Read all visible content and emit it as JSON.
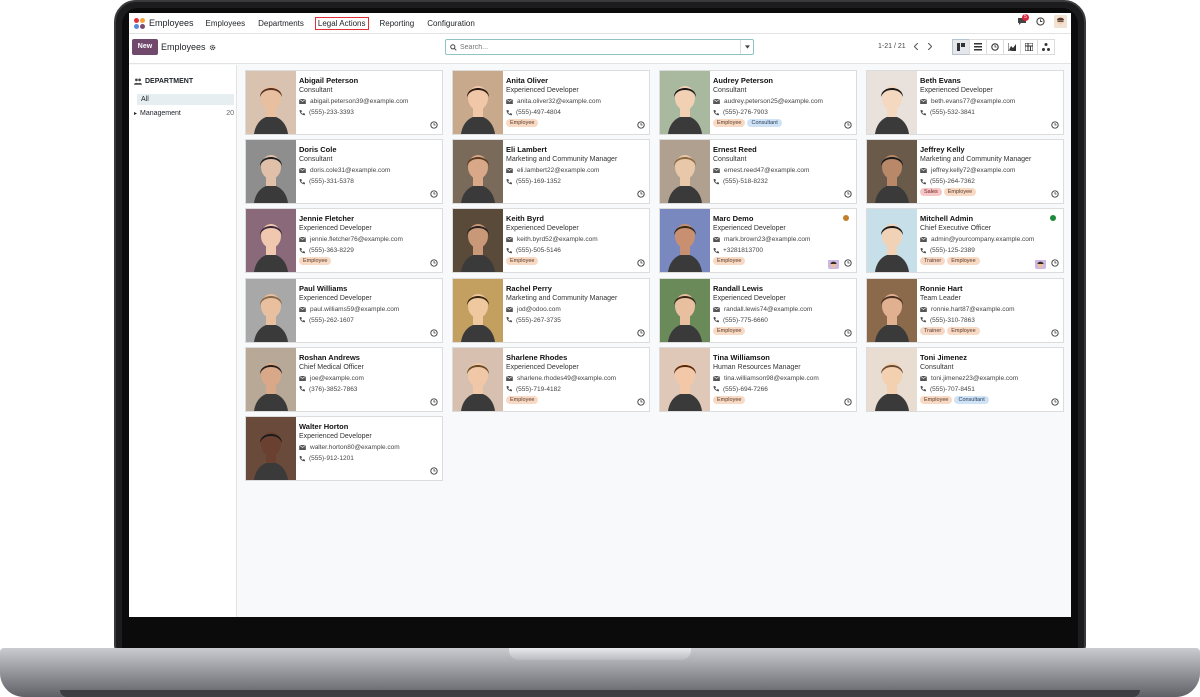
{
  "navbar": {
    "app_name": "Employees",
    "menu": [
      "Employees",
      "Departments",
      "Legal Actions",
      "Reporting",
      "Configuration"
    ],
    "chat_badge": "5",
    "colors": {
      "active_outline": "#e0313a",
      "badge": "#d9233a"
    }
  },
  "control": {
    "new_label": "New",
    "breadcrumb": "Employees",
    "search_placeholder": "Search...",
    "pager": "1-21 / 21",
    "views": [
      "kanban-icon",
      "list-icon",
      "activity-icon",
      "graph-icon",
      "pivot-icon",
      "hierarchy-icon"
    ],
    "colors": {
      "primary": "#71496c"
    }
  },
  "sidebar": {
    "title": "DEPARTMENT",
    "all_label": "All",
    "items": [
      {
        "label": "Management",
        "count": "20"
      }
    ]
  },
  "employees": [
    {
      "name": "Abigail Peterson",
      "job": "Consultant",
      "email": "abigail.peterson39@example.com",
      "phone": "(555)-233-3393",
      "tags": []
    },
    {
      "name": "Anita Oliver",
      "job": "Experienced Developer",
      "email": "anita.oliver32@example.com",
      "phone": "(555)-497-4804",
      "tags": [
        "Employee"
      ]
    },
    {
      "name": "Audrey Peterson",
      "job": "Consultant",
      "email": "audrey.peterson25@example.com",
      "phone": "(555)-276-7903",
      "tags": [
        "Employee",
        "Consultant"
      ]
    },
    {
      "name": "Beth Evans",
      "job": "Experienced Developer",
      "email": "beth.evans77@example.com",
      "phone": "(555)-532-3841",
      "tags": []
    },
    {
      "name": "Doris Cole",
      "job": "Consultant",
      "email": "doris.cole31@example.com",
      "phone": "(555)-331-5378",
      "tags": []
    },
    {
      "name": "Eli Lambert",
      "job": "Marketing and Community Manager",
      "email": "eli.lambert22@example.com",
      "phone": "(555)-169-1352",
      "tags": []
    },
    {
      "name": "Ernest Reed",
      "job": "Consultant",
      "email": "ernest.reed47@example.com",
      "phone": "(555)-518-8232",
      "tags": []
    },
    {
      "name": "Jeffrey Kelly",
      "job": "Marketing and Community Manager",
      "email": "jeffrey.kelly72@example.com",
      "phone": "(555)-264-7362",
      "tags": [
        "Sales",
        "Employee"
      ]
    },
    {
      "name": "Jennie Fletcher",
      "job": "Experienced Developer",
      "email": "jennie.fletcher76@example.com",
      "phone": "(555)-363-8229",
      "tags": [
        "Employee"
      ]
    },
    {
      "name": "Keith Byrd",
      "job": "Experienced Developer",
      "email": "keith.byrd52@example.com",
      "phone": "(555)-505-5146",
      "tags": [
        "Employee"
      ]
    },
    {
      "name": "Marc Demo",
      "job": "Experienced Developer",
      "email": "mark.brown23@example.com",
      "phone": "+3281813700",
      "tags": [
        "Employee"
      ],
      "status": "#c47f2c",
      "mini_avatar": true
    },
    {
      "name": "Mitchell Admin",
      "job": "Chief Executive Officer",
      "email": "admin@yourcompany.example.com",
      "phone": "(555)-125-2389",
      "tags": [
        "Trainer",
        "Employee"
      ],
      "status": "#1e8a3a",
      "mini_avatar": true
    },
    {
      "name": "Paul Williams",
      "job": "Experienced Developer",
      "email": "paul.williams59@example.com",
      "phone": "(555)-262-1607",
      "tags": []
    },
    {
      "name": "Rachel Perry",
      "job": "Marketing and Community Manager",
      "email": "jod@odoo.com",
      "phone": "(555)-267-3735",
      "tags": []
    },
    {
      "name": "Randall Lewis",
      "job": "Experienced Developer",
      "email": "randall.lewis74@example.com",
      "phone": "(555)-775-6660",
      "tags": [
        "Employee"
      ]
    },
    {
      "name": "Ronnie Hart",
      "job": "Team Leader",
      "email": "ronnie.hart87@example.com",
      "phone": "(555)-310-7863",
      "tags": [
        "Trainer",
        "Employee"
      ]
    },
    {
      "name": "Roshan Andrews",
      "job": "Chief Medical Officer",
      "email": "joe@example.com",
      "phone": "(376)-3852-7863",
      "tags": []
    },
    {
      "name": "Sharlene Rhodes",
      "job": "Experienced Developer",
      "email": "sharlene.rhodes49@example.com",
      "phone": "(555)-719-4182",
      "tags": [
        "Employee"
      ]
    },
    {
      "name": "Tina Williamson",
      "job": "Human Resources Manager",
      "email": "tina.williamson98@example.com",
      "phone": "(555)-694-7266",
      "tags": [
        "Employee"
      ]
    },
    {
      "name": "Toni Jimenez",
      "job": "Consultant",
      "email": "toni.jimenez23@example.com",
      "phone": "(555)-707-8451",
      "tags": [
        "Employee",
        "Consultant"
      ]
    },
    {
      "name": "Walter Horton",
      "job": "Experienced Developer",
      "email": "walter.horton80@example.com",
      "phone": "(555)-912-1201",
      "tags": []
    }
  ]
}
